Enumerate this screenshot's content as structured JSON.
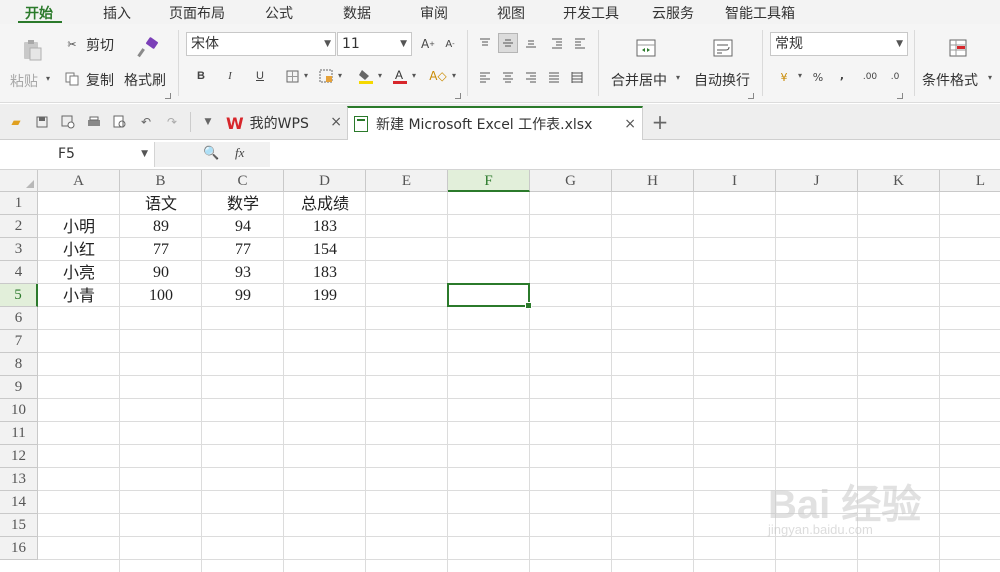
{
  "menu": {
    "tabs": [
      "开始",
      "插入",
      "页面布局",
      "公式",
      "数据",
      "审阅",
      "视图",
      "开发工具",
      "云服务",
      "智能工具箱"
    ],
    "active": "开始"
  },
  "ribbon": {
    "paste": "粘贴",
    "cut": "剪切",
    "copy": "复制",
    "format_painter": "格式刷",
    "font_name": "宋体",
    "font_size": "11",
    "bold": "B",
    "italic": "I",
    "underline": "U",
    "merge_center": "合并居中",
    "wrap_text": "自动换行",
    "number_format": "常规",
    "percent": "%",
    "comma": ",",
    "inc_decimal": ".00",
    "dec_decimal": ".0",
    "cond_format": "条件格式",
    "font_color_accent": "#d7262b",
    "fill_color_accent": "#f5d800"
  },
  "quickbar": {
    "tabs": [
      {
        "label": "我的WPS",
        "close": "×"
      },
      {
        "label": "新建 Microsoft Excel 工作表.xlsx",
        "close": "×"
      }
    ],
    "add": "+"
  },
  "formula_bar": {
    "name_box": "F5",
    "fx": "fx",
    "value": ""
  },
  "sheet": {
    "columns": [
      "A",
      "B",
      "C",
      "D",
      "E",
      "F",
      "G",
      "H",
      "I",
      "J",
      "K",
      "L"
    ],
    "rows": [
      "1",
      "2",
      "3",
      "4",
      "5",
      "6",
      "7",
      "8",
      "9",
      "10",
      "11",
      "12",
      "13",
      "14",
      "15",
      "16"
    ],
    "selected_cell": "F5",
    "cells": [
      [
        "",
        "语文",
        "数学",
        "总成绩"
      ],
      [
        "小明",
        "89",
        "94",
        "183"
      ],
      [
        "小红",
        "77",
        "77",
        "154"
      ],
      [
        "小亮",
        "90",
        "93",
        "183"
      ],
      [
        "小青",
        "100",
        "99",
        "199"
      ]
    ],
    "accent": "#2b7a2b"
  },
  "watermark": {
    "brand": "Bai 经验",
    "url": "jingyan.baidu.com"
  }
}
